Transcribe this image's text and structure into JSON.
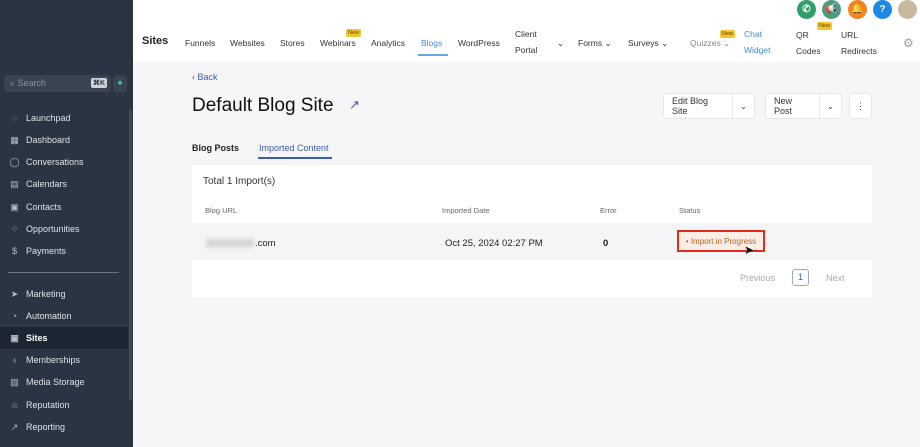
{
  "sidebar": {
    "search_placeholder": "Search",
    "shortcut": "⌘K",
    "items": [
      {
        "label": "Launchpad",
        "icon": "rocket-icon"
      },
      {
        "label": "Dashboard",
        "icon": "grid-icon"
      },
      {
        "label": "Conversations",
        "icon": "chat-icon"
      },
      {
        "label": "Calendars",
        "icon": "calendar-icon"
      },
      {
        "label": "Contacts",
        "icon": "contacts-icon"
      },
      {
        "label": "Opportunities",
        "icon": "opportunities-icon"
      },
      {
        "label": "Payments",
        "icon": "payments-icon"
      }
    ],
    "items2": [
      {
        "label": "Marketing",
        "icon": "send-icon"
      },
      {
        "label": "Automation",
        "icon": "automation-icon"
      },
      {
        "label": "Sites",
        "icon": "sites-icon",
        "active": true
      },
      {
        "label": "Memberships",
        "icon": "badge-icon"
      },
      {
        "label": "Media Storage",
        "icon": "image-icon"
      },
      {
        "label": "Reputation",
        "icon": "star-icon"
      },
      {
        "label": "Reporting",
        "icon": "trend-icon"
      }
    ]
  },
  "header": {
    "title": "Sites",
    "new_badge": "New",
    "nav": [
      "Funnels",
      "Websites",
      "Stores",
      "Webinars",
      "Analytics",
      "Blogs",
      "WordPress",
      "Client",
      "Portal",
      "Forms",
      "Surveys",
      "Quizzes",
      "Chat",
      "Widget",
      "QR",
      "Codes",
      "URL",
      "Redirects"
    ]
  },
  "page": {
    "back": "Back",
    "title": "Default Blog Site",
    "edit_button": "Edit Blog Site",
    "new_post_button": "New Post",
    "tabs": [
      "Blog Posts",
      "Imported Content"
    ],
    "total": "Total 1 Import(s)",
    "columns": [
      "Blog URL",
      "Imported Date",
      "Error",
      "Status"
    ],
    "rows": [
      {
        "url_suffix": ".com",
        "date": "Oct 25, 2024 02:27 PM",
        "error": "0",
        "status": "• Import in Progress"
      }
    ],
    "pagination": {
      "previous": "Previous",
      "page": "1",
      "next": "Next"
    }
  },
  "colors": {
    "accent": "#3b5bb0",
    "sidebar": "#2b3443",
    "status": "#b8631f",
    "highlight": "#e02b1f"
  }
}
